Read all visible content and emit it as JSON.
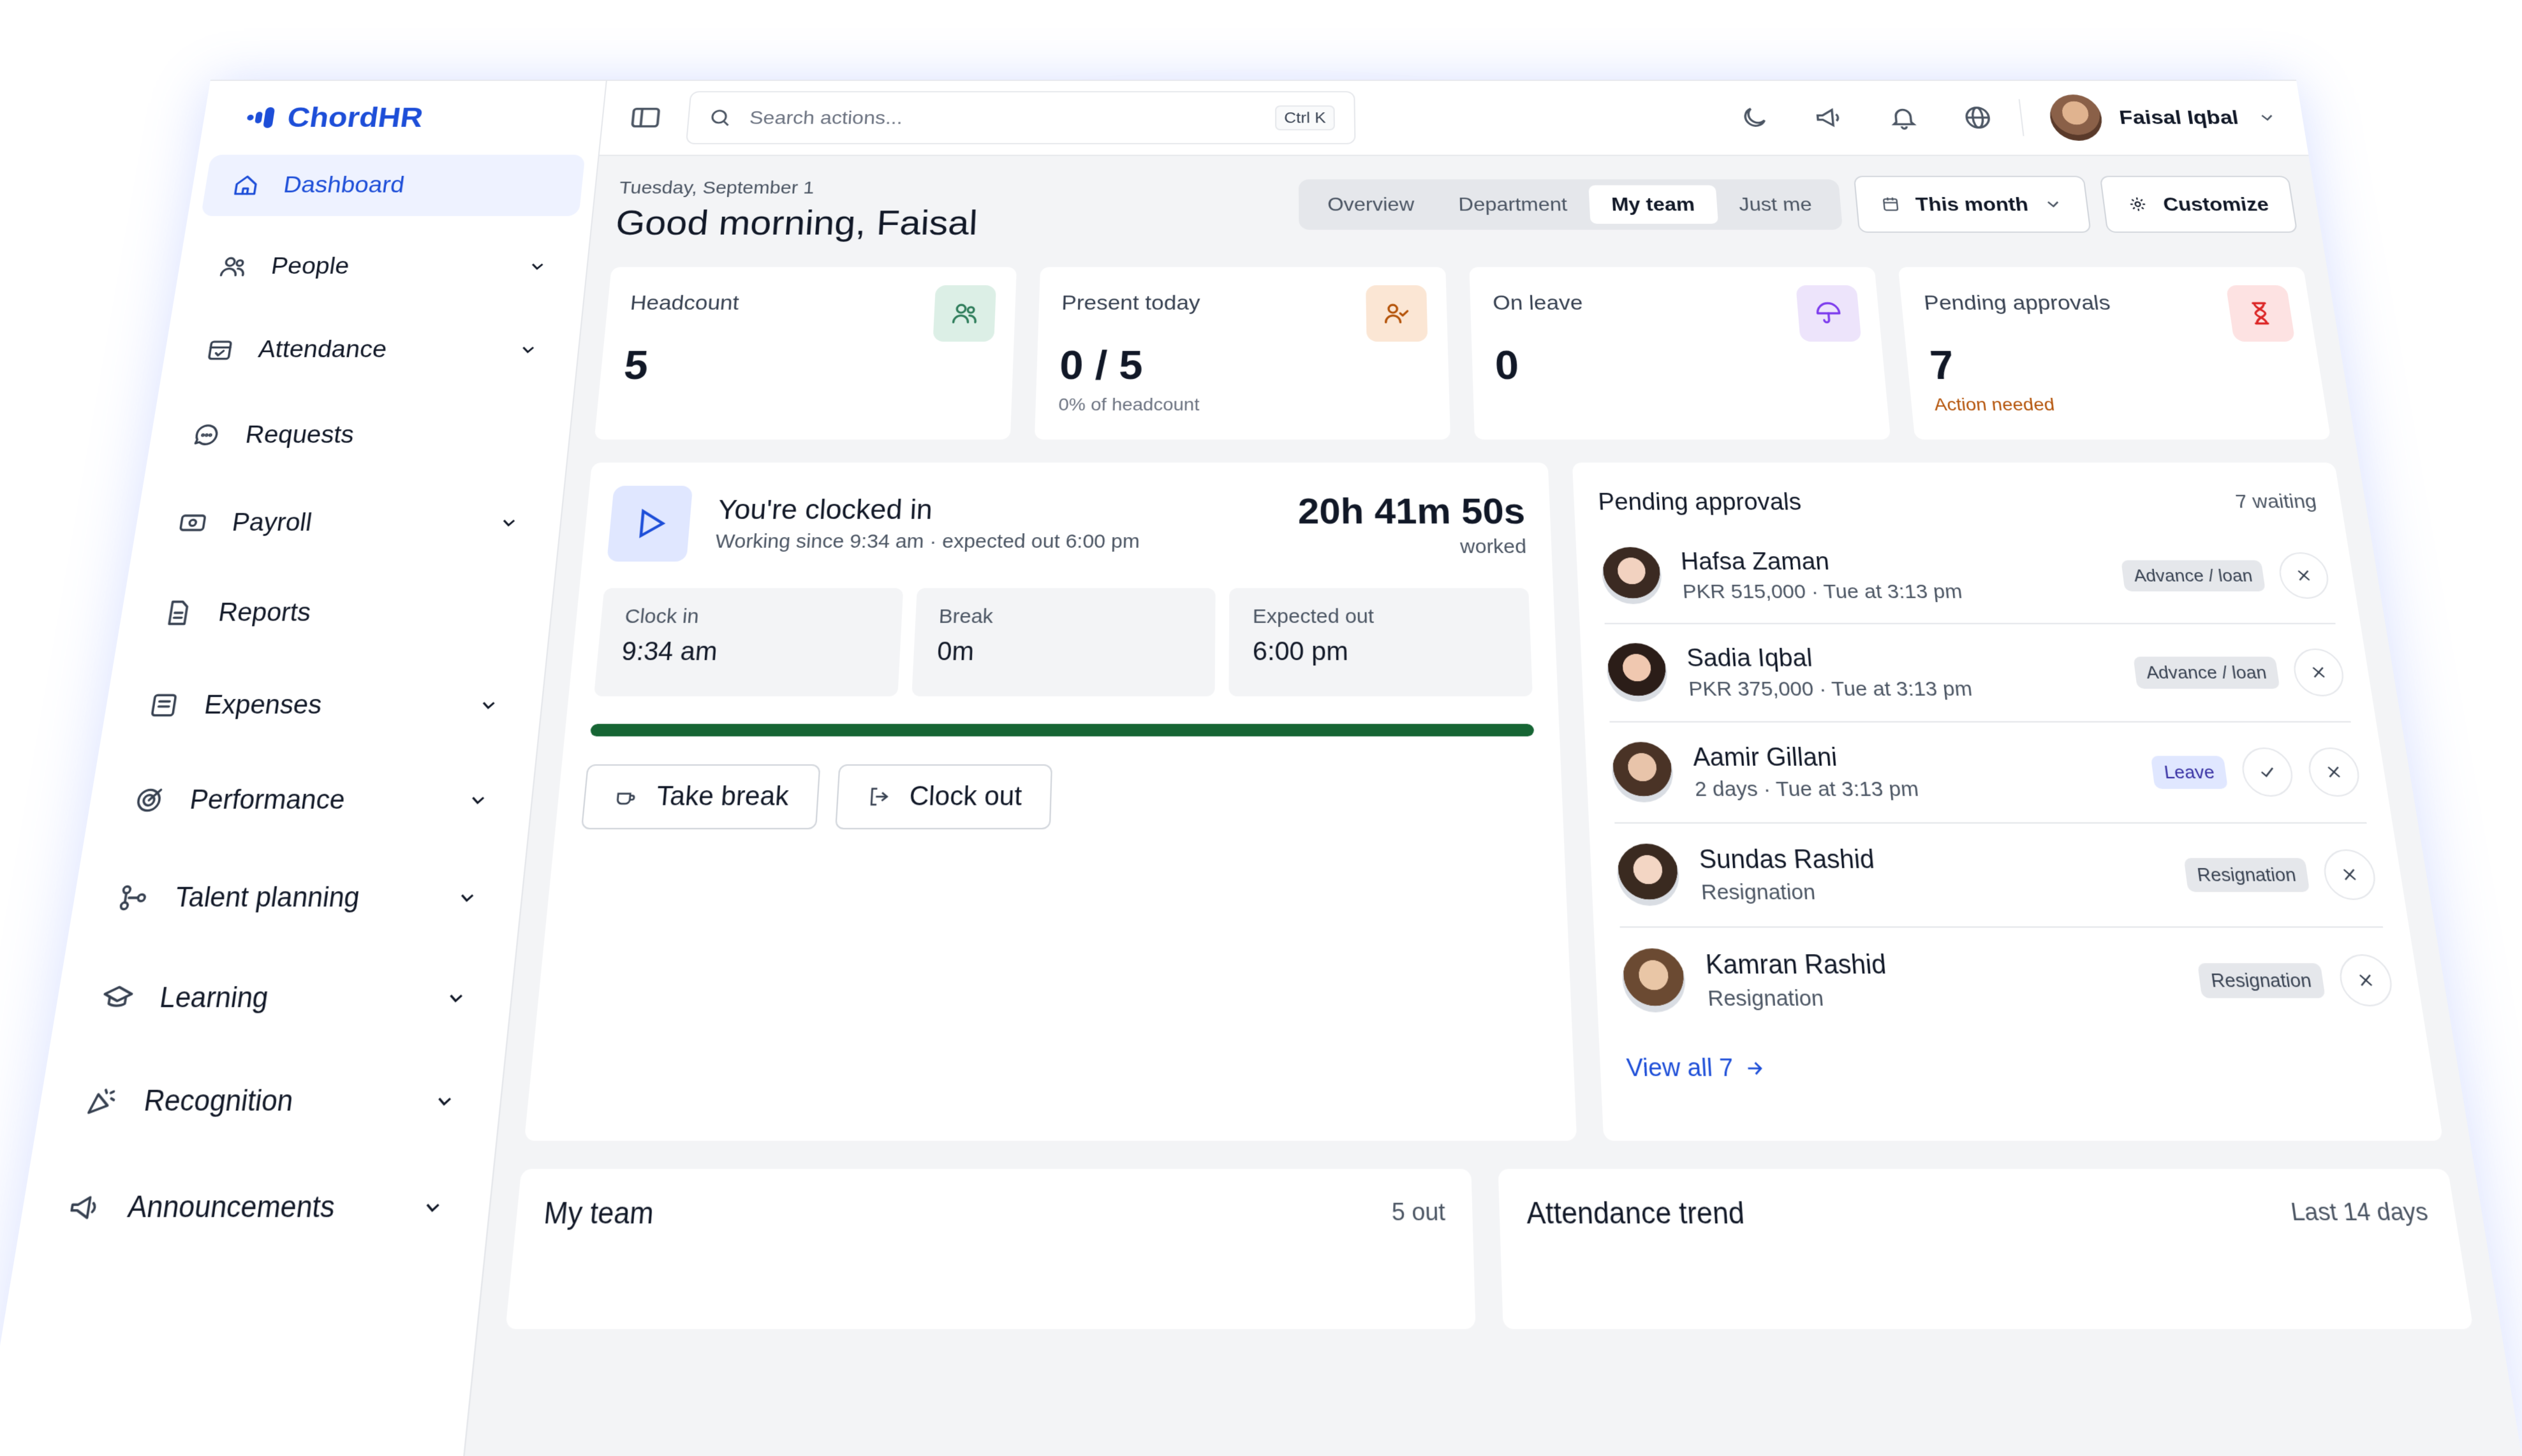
{
  "app": {
    "brand": "ChordHR"
  },
  "sidebar": {
    "items": [
      {
        "label": "Dashboard",
        "icon": "home-icon",
        "active": true,
        "expandable": false
      },
      {
        "label": "People",
        "icon": "users-icon",
        "expandable": true
      },
      {
        "label": "Attendance",
        "icon": "calendar-check-icon",
        "expandable": true
      },
      {
        "label": "Requests",
        "icon": "message-icon",
        "expandable": false
      },
      {
        "label": "Payroll",
        "icon": "money-icon",
        "expandable": true
      },
      {
        "label": "Reports",
        "icon": "file-icon",
        "expandable": false
      },
      {
        "label": "Expenses",
        "icon": "receipt-icon",
        "expandable": true
      },
      {
        "label": "Performance",
        "icon": "target-icon",
        "expandable": true
      },
      {
        "label": "Talent planning",
        "icon": "org-chart-icon",
        "expandable": true
      },
      {
        "label": "Learning",
        "icon": "graduation-cap-icon",
        "expandable": true
      },
      {
        "label": "Recognition",
        "icon": "party-popper-icon",
        "expandable": true
      },
      {
        "label": "Announcements",
        "icon": "megaphone-icon",
        "expandable": true
      }
    ]
  },
  "topbar": {
    "search_placeholder": "Search actions...",
    "search_shortcut": "Ctrl K",
    "user_name": "Faisal Iqbal"
  },
  "header": {
    "date": "Tuesday, September 1",
    "greeting": "Good morning, Faisal",
    "tabs": [
      "Overview",
      "Department",
      "My team",
      "Just me"
    ],
    "active_tab": "My team",
    "period": "This month",
    "customize": "Customize"
  },
  "stats_cards": [
    {
      "title": "Headcount",
      "value": "5",
      "sub": "",
      "icon": "users-icon",
      "icon_bg": "#dcefe6",
      "icon_color": "#2f7d5b"
    },
    {
      "title": "Present today",
      "value": "0 / 5",
      "sub": "0% of headcount",
      "icon": "user-check-icon",
      "icon_bg": "#fbe6d4",
      "icon_color": "#b45309"
    },
    {
      "title": "On leave",
      "value": "0",
      "sub": "",
      "icon": "umbrella-icon",
      "icon_bg": "#ede4fb",
      "icon_color": "#7c3aed"
    },
    {
      "title": "Pending approvals",
      "value": "7",
      "sub": "Action needed",
      "icon": "hourglass-icon",
      "icon_bg": "#fde2e2",
      "icon_color": "#dc2626"
    }
  ],
  "clock": {
    "title": "You're clocked in",
    "subtitle": "Working since 9:34 am · expected out 6:00 pm",
    "timer": "20h 41m 50s",
    "timer_label": "worked",
    "stats": [
      {
        "label": "Clock in",
        "value": "9:34 am"
      },
      {
        "label": "Break",
        "value": "0m"
      },
      {
        "label": "Expected out",
        "value": "6:00 pm"
      }
    ],
    "progress": 1.0,
    "progress_color": "#166534",
    "take_break": "Take break",
    "clock_out": "Clock out"
  },
  "approvals": {
    "title": "Pending approvals",
    "count": "7 waiting",
    "items": [
      {
        "name": "Hafsa Zaman",
        "sub": "PKR 515,000 · Tue at 3:13 pm",
        "badge": "Advance / loan",
        "approve": false
      },
      {
        "name": "Sadia Iqbal",
        "sub": "PKR 375,000 · Tue at 3:13 pm",
        "badge": "Advance / loan",
        "approve": false
      },
      {
        "name": "Aamir Gillani",
        "sub": "2 days · Tue at 3:13 pm",
        "badge": "Leave",
        "approve": true
      },
      {
        "name": "Sundas Rashid",
        "sub": "Resignation",
        "badge": "Resignation",
        "approve": false
      },
      {
        "name": "Kamran Rashid",
        "sub": "Resignation",
        "badge": "Resignation",
        "approve": false
      }
    ],
    "view_all": "View all 7"
  },
  "bottom": {
    "team_title": "My team",
    "team_meta": "5 out",
    "trend_title": "Attendance trend",
    "trend_meta": "Last 14 days"
  },
  "colors": {
    "accent": "#1d4ed8",
    "active_nav_bg": "#eef2ff"
  }
}
